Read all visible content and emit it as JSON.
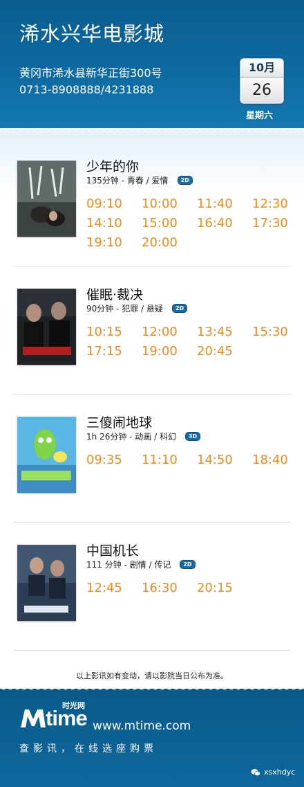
{
  "header": {
    "cinema_name": "浠水兴华电影城",
    "address": "黄冈市浠水县新华正街300号",
    "phone": "0713-8908888/4231888",
    "calendar": {
      "month": "10月",
      "day": "26",
      "weekday": "星期六"
    }
  },
  "movies": [
    {
      "title": "少年的你",
      "meta": "135分钟 - 青春 / 爱情",
      "format": "2D",
      "times": [
        "09:10",
        "10:00",
        "11:40",
        "12:30",
        "14:10",
        "15:00",
        "16:40",
        "17:30",
        "19:10",
        "20:00"
      ]
    },
    {
      "title": "催眠·裁决",
      "meta": "90分钟 - 犯罪 / 悬疑",
      "format": "2D",
      "times": [
        "10:15",
        "12:00",
        "13:45",
        "15:30",
        "17:15",
        "19:00",
        "20:45"
      ]
    },
    {
      "title": "三傻闹地球",
      "meta": "1h 26分钟 - 动画 / 科幻",
      "format": "3D",
      "times": [
        "09:35",
        "11:10",
        "14:50",
        "18:40"
      ]
    },
    {
      "title": "中国机长",
      "meta": "111 分钟 - 剧情 / 传记",
      "format": "2D",
      "times": [
        "12:45",
        "16:30",
        "20:15"
      ]
    }
  ],
  "notice": "以上影讯如有变动，请以影院当日公布为准。",
  "footer": {
    "logo_text": "time",
    "logo_cn": "时光网",
    "site": "www.mtime.com",
    "slogan": "查影讯，在线选座购票",
    "wechat_id": "xsxhdyc"
  },
  "colors": {
    "header_blue": "#0e6aa0",
    "time_orange": "#f08a1a",
    "format_badge": "#1a6aa6"
  }
}
